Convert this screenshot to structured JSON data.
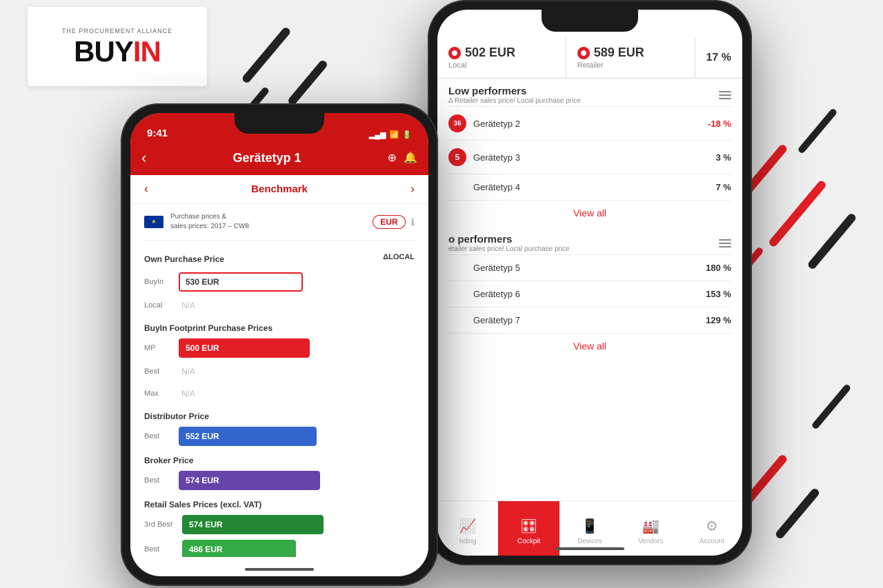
{
  "logo": {
    "tagline": "THE PROCUREMENT ALLIANCE",
    "text_buy": "BUY",
    "text_in": "IN"
  },
  "phone_left": {
    "status": {
      "time": "9:41",
      "signal_bars": "▂▄▆",
      "wifi": "wifi",
      "battery": "battery"
    },
    "nav": {
      "back_label": "‹",
      "title": "Gerätetyp 1",
      "cockpit_icon": "cockpit",
      "bell_icon": "bell"
    },
    "benchmark": {
      "prev_label": "‹",
      "tab_label": "Benchmark",
      "next_label": "›"
    },
    "currency_row": {
      "flag": "EU",
      "description": "Purchase prices &\nsales prices: 2017 – CW8",
      "badge": "EUR",
      "info": "ℹ"
    },
    "own_purchase": {
      "header": "Own Purchase Price",
      "delta_label": "ΔLOCAL",
      "buyin_label": "BuyIn",
      "buyin_value": "530 EUR",
      "local_label": "Local",
      "local_value": "N/A"
    },
    "footprint": {
      "header": "BuyIn Footprint Purchase Prices",
      "mp_label": "MP",
      "mp_value": "500 EUR",
      "best_label": "Best",
      "best_value": "N/A",
      "max_label": "Max",
      "max_value": "N/A"
    },
    "distributor": {
      "header": "Distributor Price",
      "best_label": "Best",
      "best_value": "552 EUR"
    },
    "broker": {
      "header": "Broker Price",
      "best_label": "Best",
      "best_value": "574 EUR"
    },
    "retail": {
      "header": "Retail Sales Prices (excl. VAT)",
      "third_best_label": "3rd Best",
      "third_best_value": "574 EUR",
      "best_label": "Best",
      "best_value": "486 EUR"
    }
  },
  "phone_right": {
    "price_compare": {
      "left_price": "502 EUR",
      "left_label": "Local",
      "right_price": "589 EUR",
      "right_label": "Retailer",
      "percentage": "17 %"
    },
    "low_performers": {
      "title": "Low performers",
      "subtitle": "Δ Retailer sales price/ Local purchase price",
      "items": [
        {
          "badge": "36",
          "name": "Gerätetyp 2",
          "pct": "-18 %",
          "negative": true
        },
        {
          "badge": "5",
          "name": "Gerätetyp 3",
          "pct": "3 %",
          "negative": false
        },
        {
          "badge": "",
          "name": "Gerätetyp 4",
          "pct": "7 %",
          "negative": false
        }
      ],
      "view_all": "View all"
    },
    "top_performers": {
      "title": "o performers",
      "subtitle": "etailer sales price/ Local purchase price",
      "items": [
        {
          "badge": "",
          "name": "Gerätetyp 5",
          "pct": "180 %",
          "negative": false
        },
        {
          "badge": "",
          "name": "Gerätetyp 6",
          "pct": "153 %",
          "negative": false
        },
        {
          "badge": "",
          "name": "Gerätetyp 7",
          "pct": "129 %",
          "negative": false
        }
      ],
      "view_all": "View all"
    },
    "tabs": [
      {
        "id": "trending",
        "label": "nding",
        "icon": "📈",
        "active": false
      },
      {
        "id": "cockpit",
        "label": "Cockpit",
        "icon": "🎛",
        "active": true
      },
      {
        "id": "devices",
        "label": "Devices",
        "icon": "📱",
        "active": false
      },
      {
        "id": "vendors",
        "label": "Vendors",
        "icon": "🏭",
        "active": false
      },
      {
        "id": "account",
        "label": "Account",
        "icon": "⚙",
        "active": false
      }
    ]
  }
}
